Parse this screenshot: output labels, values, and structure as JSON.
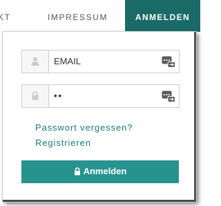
{
  "nav": {
    "items": [
      {
        "label": "KT"
      },
      {
        "label": "IMPRESSUM"
      },
      {
        "label": "ANMELDEN",
        "active": true
      }
    ],
    "active_color": "#1a6b68"
  },
  "login": {
    "email": {
      "value": "EMAIL",
      "icon": "user-icon"
    },
    "password": {
      "value": "••",
      "icon": "lock-icon"
    },
    "password_manager_icon": "password-manager-icon",
    "forgot_link": "Passwort vergessen?",
    "register_link": "Registrieren",
    "submit_label": "Anmelden",
    "submit_icon": "lock-icon",
    "button_color": "#27938e",
    "link_color": "#1a7a77"
  }
}
